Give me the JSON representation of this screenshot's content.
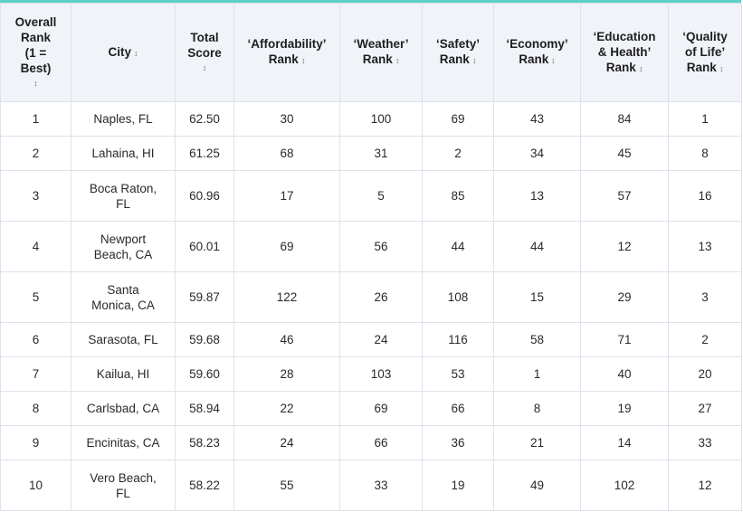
{
  "table": {
    "columns": [
      {
        "lines": [
          "Overall",
          "Rank",
          "(1 =",
          "Best)"
        ],
        "sort_icon": "↕",
        "sort_on_own_line": true
      },
      {
        "lines": [
          "City"
        ],
        "sort_icon": "↕",
        "sort_on_own_line": false
      },
      {
        "lines": [
          "Total",
          "Score"
        ],
        "sort_icon": "↕",
        "sort_on_own_line": true
      },
      {
        "lines": [
          "‘Affordability’",
          "Rank"
        ],
        "sort_icon": "↕",
        "sort_on_own_line": false
      },
      {
        "lines": [
          "‘Weather’",
          "Rank"
        ],
        "sort_icon": "↕",
        "sort_on_own_line": false
      },
      {
        "lines": [
          "‘Safety’",
          "Rank"
        ],
        "sort_icon": "↕",
        "sort_on_own_line": false
      },
      {
        "lines": [
          "‘Economy’",
          "Rank"
        ],
        "sort_icon": "↕",
        "sort_on_own_line": false
      },
      {
        "lines": [
          "‘Education",
          "& Health’",
          "Rank"
        ],
        "sort_icon": "↕",
        "sort_on_own_line": false
      },
      {
        "lines": [
          "‘Quality",
          "of Life’",
          "Rank"
        ],
        "sort_icon": "↕",
        "sort_on_own_line": false
      }
    ],
    "rows": [
      {
        "rank": "1",
        "city": [
          "Naples, FL"
        ],
        "score": "62.50",
        "affordability": "30",
        "weather": "100",
        "safety": "69",
        "economy": "43",
        "education_health": "84",
        "quality_of_life": "1"
      },
      {
        "rank": "2",
        "city": [
          "Lahaina, HI"
        ],
        "score": "61.25",
        "affordability": "68",
        "weather": "31",
        "safety": "2",
        "economy": "34",
        "education_health": "45",
        "quality_of_life": "8"
      },
      {
        "rank": "3",
        "city": [
          "Boca Raton,",
          "FL"
        ],
        "score": "60.96",
        "affordability": "17",
        "weather": "5",
        "safety": "85",
        "economy": "13",
        "education_health": "57",
        "quality_of_life": "16"
      },
      {
        "rank": "4",
        "city": [
          "Newport",
          "Beach, CA"
        ],
        "score": "60.01",
        "affordability": "69",
        "weather": "56",
        "safety": "44",
        "economy": "44",
        "education_health": "12",
        "quality_of_life": "13"
      },
      {
        "rank": "5",
        "city": [
          "Santa",
          "Monica, CA"
        ],
        "score": "59.87",
        "affordability": "122",
        "weather": "26",
        "safety": "108",
        "economy": "15",
        "education_health": "29",
        "quality_of_life": "3"
      },
      {
        "rank": "6",
        "city": [
          "Sarasota, FL"
        ],
        "score": "59.68",
        "affordability": "46",
        "weather": "24",
        "safety": "116",
        "economy": "58",
        "education_health": "71",
        "quality_of_life": "2"
      },
      {
        "rank": "7",
        "city": [
          "Kailua, HI"
        ],
        "score": "59.60",
        "affordability": "28",
        "weather": "103",
        "safety": "53",
        "economy": "1",
        "education_health": "40",
        "quality_of_life": "20"
      },
      {
        "rank": "8",
        "city": [
          "Carlsbad, CA"
        ],
        "score": "58.94",
        "affordability": "22",
        "weather": "69",
        "safety": "66",
        "economy": "8",
        "education_health": "19",
        "quality_of_life": "27"
      },
      {
        "rank": "9",
        "city": [
          "Encinitas, CA"
        ],
        "score": "58.23",
        "affordability": "24",
        "weather": "66",
        "safety": "36",
        "economy": "21",
        "education_health": "14",
        "quality_of_life": "33"
      },
      {
        "rank": "10",
        "city": [
          "Vero Beach,",
          "FL"
        ],
        "score": "58.22",
        "affordability": "55",
        "weather": "33",
        "safety": "19",
        "economy": "49",
        "education_health": "102",
        "quality_of_life": "12"
      }
    ]
  },
  "colors": {
    "accent_bar": "#5fcfc8",
    "header_bg": "#f0f3f7",
    "grid": "#dde2ea"
  }
}
